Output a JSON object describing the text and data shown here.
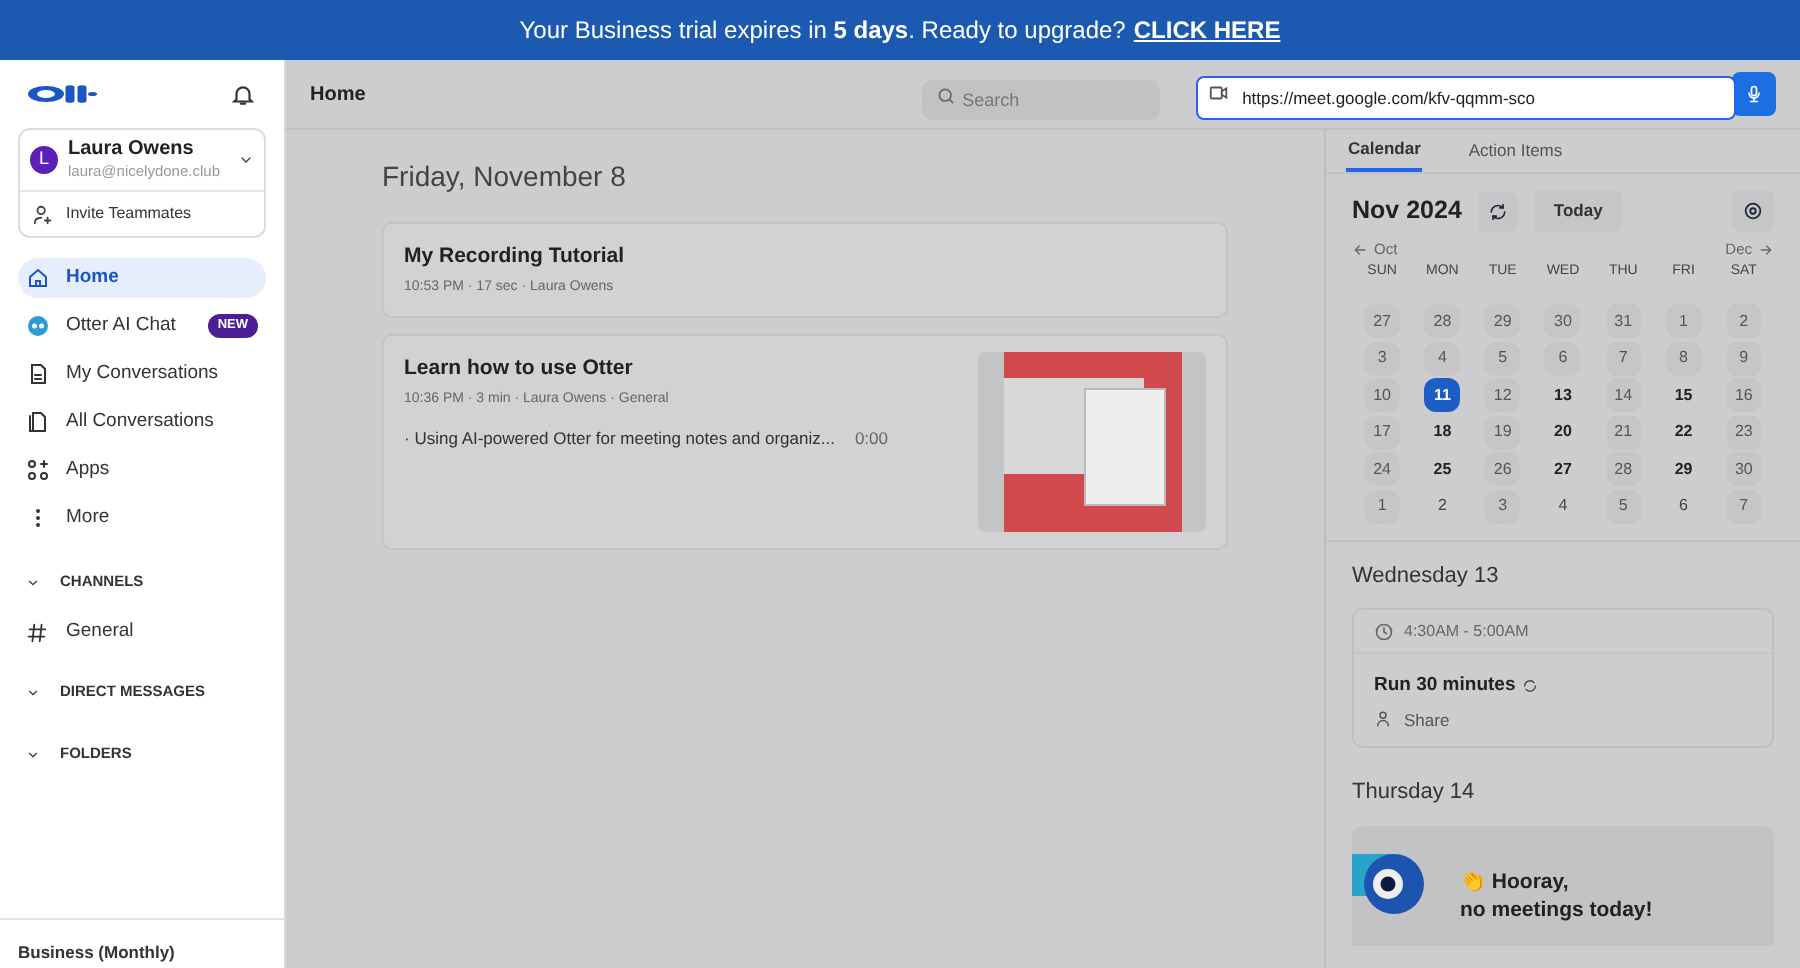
{
  "banner": {
    "text": "Your Business trial expires in **5 days**. Ready to upgrade?",
    "link": "CLICK HERE"
  },
  "sidebar": {
    "user": {
      "initial": "L",
      "name": "Laura Owens",
      "email": "laura@nicelydone.club"
    },
    "invite": "Invite Teammates",
    "items": [
      {
        "label": "Home",
        "selected": true
      },
      {
        "label": "Otter AI Chat",
        "selected": false,
        "badge": "NEW"
      },
      {
        "label": "My Conversations",
        "selected": false
      },
      {
        "label": "All Conversations",
        "selected": false
      },
      {
        "label": "Apps",
        "selected": false
      },
      {
        "label": "More",
        "selected": false
      }
    ],
    "sections": [
      {
        "label": "CHANNELS",
        "expanded": true,
        "children": [
          {
            "label": "General"
          }
        ]
      },
      {
        "label": "DIRECT MESSAGES",
        "expanded": true
      },
      {
        "label": "FOLDERS",
        "expanded": true
      }
    ],
    "plan": "Business (Monthly)"
  },
  "header": {
    "title": "Home",
    "search": {
      "placeholder": "Search"
    },
    "url_field": {
      "value": "https://meet.google.com/kfv-qqmm-sco"
    }
  },
  "feed": {
    "date": "Friday, November 8",
    "conversations": [
      {
        "title": "My Recording Tutorial",
        "meta": "10:53 PM  ·  17 sec  ·  Laura Owens"
      },
      {
        "title": "Learn how to use Otter",
        "meta": "10:36 PM  ·  3 min  ·  Laura Owens  ·  General",
        "snippet": "· Using AI-powered Otter for meeting notes and organiz...",
        "snippet_time": "0:00",
        "thumbnail": true
      }
    ]
  },
  "right_panel": {
    "tabs": [
      {
        "label": "Calendar",
        "selected": true
      },
      {
        "label": "Action Items",
        "selected": false
      }
    ],
    "calendar": {
      "month": "Nov 2024",
      "today_button": "Today",
      "prev": "Oct",
      "next": "Dec",
      "weekdays": [
        "SUN",
        "MON",
        "TUE",
        "WED",
        "THU",
        "FRI",
        "SAT"
      ],
      "days": [
        {
          "label": "27",
          "kind": "shaded",
          "selected": false
        },
        {
          "label": "28",
          "kind": "shaded",
          "selected": false
        },
        {
          "label": "29",
          "kind": "shaded",
          "selected": false
        },
        {
          "label": "30",
          "kind": "shaded",
          "selected": false
        },
        {
          "label": "31",
          "kind": "shaded",
          "selected": false
        },
        {
          "label": "1",
          "kind": "shaded",
          "selected": false
        },
        {
          "label": "2",
          "kind": "shaded",
          "selected": false
        },
        {
          "label": "3",
          "kind": "shaded",
          "selected": false
        },
        {
          "label": "4",
          "kind": "shaded",
          "selected": false
        },
        {
          "label": "5",
          "kind": "shaded",
          "selected": false
        },
        {
          "label": "6",
          "kind": "shaded",
          "selected": false
        },
        {
          "label": "7",
          "kind": "shaded",
          "selected": false
        },
        {
          "label": "8",
          "kind": "shaded",
          "selected": false
        },
        {
          "label": "9",
          "kind": "shaded",
          "selected": false
        },
        {
          "label": "10",
          "kind": "shaded",
          "selected": false
        },
        {
          "label": "11",
          "kind": "shaded",
          "selected": true
        },
        {
          "label": "12",
          "kind": "shaded",
          "selected": false
        },
        {
          "label": "13",
          "kind": "bold",
          "selected": false
        },
        {
          "label": "14",
          "kind": "shaded",
          "selected": false
        },
        {
          "label": "15",
          "kind": "bold",
          "selected": false
        },
        {
          "label": "16",
          "kind": "shaded",
          "selected": false
        },
        {
          "label": "17",
          "kind": "shaded",
          "selected": false
        },
        {
          "label": "18",
          "kind": "bold",
          "selected": false
        },
        {
          "label": "19",
          "kind": "shaded",
          "selected": false
        },
        {
          "label": "20",
          "kind": "bold",
          "selected": false
        },
        {
          "label": "21",
          "kind": "shaded",
          "selected": false
        },
        {
          "label": "22",
          "kind": "bold",
          "selected": false
        },
        {
          "label": "23",
          "kind": "shaded",
          "selected": false
        },
        {
          "label": "24",
          "kind": "shaded",
          "selected": false
        },
        {
          "label": "25",
          "kind": "bold",
          "selected": false
        },
        {
          "label": "26",
          "kind": "shaded",
          "selected": false
        },
        {
          "label": "27",
          "kind": "bold",
          "selected": false
        },
        {
          "label": "28",
          "kind": "shaded",
          "selected": false
        },
        {
          "label": "29",
          "kind": "bold",
          "selected": false
        },
        {
          "label": "30",
          "kind": "shaded",
          "selected": false
        },
        {
          "label": "1",
          "kind": "shaded",
          "selected": false
        },
        {
          "label": "2",
          "kind": "plain",
          "selected": false
        },
        {
          "label": "3",
          "kind": "shaded",
          "selected": false
        },
        {
          "label": "4",
          "kind": "plain",
          "selected": false
        },
        {
          "label": "5",
          "kind": "shaded",
          "selected": false
        },
        {
          "label": "6",
          "kind": "plain",
          "selected": false
        },
        {
          "label": "7",
          "kind": "shaded",
          "selected": false
        }
      ]
    },
    "agenda": [
      {
        "day": "Wednesday 13",
        "events": [
          {
            "time": "4:30AM - 5:00AM",
            "title": "Run 30 minutes",
            "recurring": true,
            "action": "Share"
          }
        ]
      },
      {
        "day": "Thursday 14",
        "empty": {
          "emoji": "👏",
          "text": "Hooray,\nno meetings today!"
        }
      }
    ]
  }
}
